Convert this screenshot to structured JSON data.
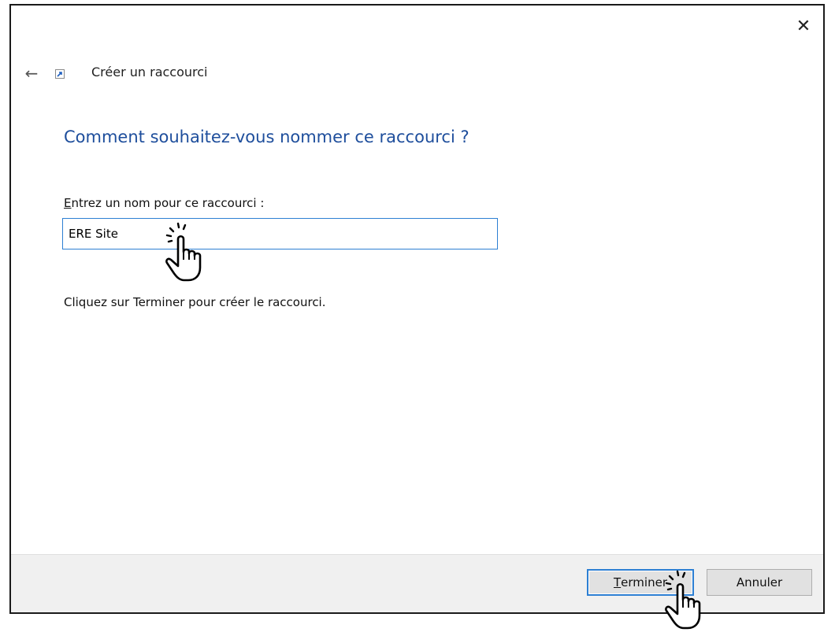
{
  "window": {
    "close_glyph": "✕",
    "back_glyph": "←",
    "title": "Créer un raccourci"
  },
  "main": {
    "instruction": "Comment souhaitez-vous nommer ce raccourci ?",
    "field_label_accesskey": "E",
    "field_label_rest": "ntrez un nom pour ce raccourci :",
    "name_value": "ERE Site",
    "hint": "Cliquez sur Terminer pour créer le raccourci."
  },
  "footer": {
    "finish_accesskey": "T",
    "finish_rest": "erminer",
    "cancel_label": "Annuler"
  },
  "colors": {
    "instruction": "#1e4e9c",
    "focus_border": "#2d7fd3",
    "footer_bg": "#f0f0f0"
  },
  "icons": {
    "close": "close-icon",
    "back": "back-arrow-icon",
    "shortcut": "shortcut-icon",
    "cursor": "hand-click-cursor-icon"
  }
}
